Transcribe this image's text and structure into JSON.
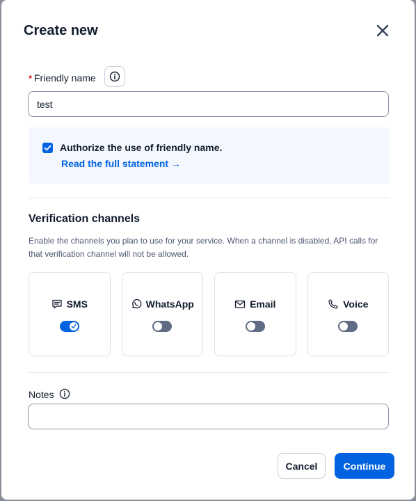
{
  "dialog": {
    "title": "Create new",
    "close_icon": "close-icon"
  },
  "friendly_name": {
    "required_marker": "*",
    "label": "Friendly name",
    "info_icon": "info-icon",
    "value": "test"
  },
  "authorization": {
    "checked": true,
    "text": "Authorize the use of friendly name.",
    "link": "Read the full statement →"
  },
  "verification": {
    "title": "Verification channels",
    "description": "Enable the channels you plan to use for your service. When a channel is disabled, API calls for that verification channel will not be allowed.",
    "channels": [
      {
        "label": "SMS",
        "icon": "chat-icon",
        "enabled": true
      },
      {
        "label": "WhatsApp",
        "icon": "whatsapp-icon",
        "enabled": false
      },
      {
        "label": "Email",
        "icon": "email-icon",
        "enabled": false
      },
      {
        "label": "Voice",
        "icon": "phone-icon",
        "enabled": false
      }
    ]
  },
  "notes": {
    "label": "Notes",
    "info_icon": "info-icon",
    "value": ""
  },
  "actions": {
    "cancel": "Cancel",
    "continue": "Continue"
  },
  "colors": {
    "primary": "#0263e0",
    "toggle_off": "#606b85",
    "required": "#d61f1f",
    "auth_bg": "#f4f8fe"
  }
}
